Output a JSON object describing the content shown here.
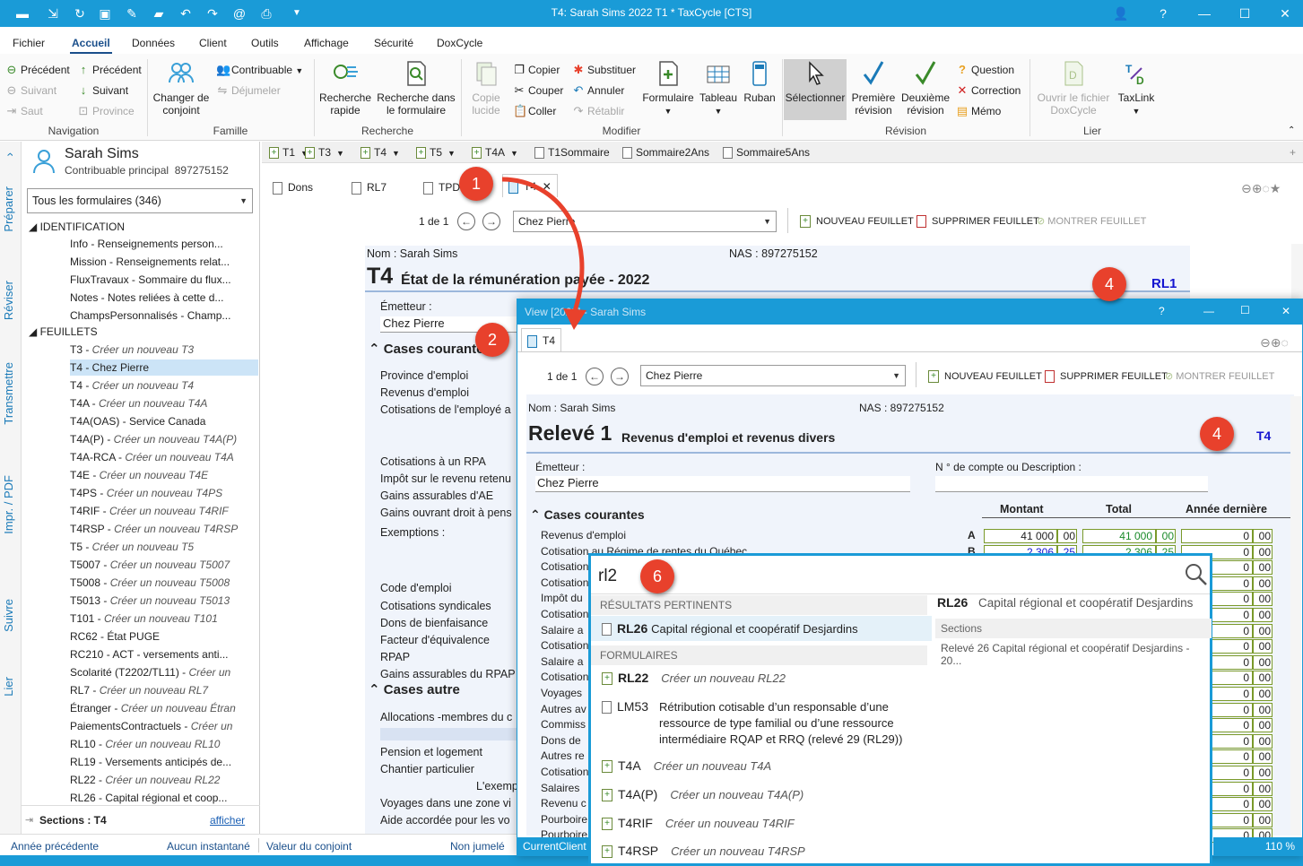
{
  "window": {
    "title": "T4: Sarah Sims 2022 T1 * TaxCycle [CTS]"
  },
  "menu": [
    "Fichier",
    "Accueil",
    "Données",
    "Client",
    "Outils",
    "Affichage",
    "Sécurité",
    "DoxCycle"
  ],
  "ribbon": {
    "prev1": "Précédent",
    "next1": "Suivant",
    "skip": "Saut",
    "prev2": "Précédent",
    "next2": "Suivant",
    "province": "Province",
    "change_spouse": "Changer de conjoint",
    "taxpayer": "Contribuable",
    "unlink": "Déjumeler",
    "quick_search": "Recherche rapide",
    "search_form": "Recherche dans le formulaire",
    "copy_lucid": "Copie lucide",
    "copy": "Copier",
    "cut": "Couper",
    "paste": "Coller",
    "substitute": "Substituer",
    "undo": "Annuler",
    "redo": "Rétablir",
    "form": "Formulaire",
    "table": "Tableau",
    "ribbon": "Ruban",
    "select": "Sélectionner",
    "first_review": "Première révision",
    "second_review": "Deuxième révision",
    "question": "Question",
    "correction": "Correction",
    "memo": "Mémo",
    "open_doxcycle": "Ouvrir le fichier DoxCycle",
    "taxlink": "TaxLink",
    "groups": {
      "navigation": "Navigation",
      "family": "Famille",
      "search": "Recherche",
      "modify": "Modifier",
      "review": "Révision",
      "link": "Lier"
    }
  },
  "sidetabs": [
    "Préparer",
    "Réviser",
    "Transmettre",
    "Impr. / PDF",
    "Suivre",
    "Lier"
  ],
  "client": {
    "name": "Sarah Sims",
    "role": "Contribuable principal",
    "sin": "897275152"
  },
  "filter": "Tous les formulaires (346)",
  "tree": {
    "identification": "IDENTIFICATION",
    "feuillets": "FEUILLETS",
    "id_items": [
      "Info - Renseignements person...",
      "Mission - Renseignements relat...",
      "FluxTravaux - Sommaire du flux...",
      "Notes - Notes reliées à cette d...",
      "ChampsPersonnalisés - Champ..."
    ],
    "slips": [
      {
        "code": "T3 - ",
        "desc": "Créer un nouveau T3"
      },
      {
        "code": "T4 - Chez Pierre",
        "desc": ""
      },
      {
        "code": "T4 - ",
        "desc": "Créer un nouveau T4"
      },
      {
        "code": "T4A - ",
        "desc": "Créer un nouveau T4A"
      },
      {
        "code": "T4A(OAS) - Service Canada",
        "desc": ""
      },
      {
        "code": "T4A(P) - ",
        "desc": "Créer un nouveau T4A(P)"
      },
      {
        "code": "T4A-RCA - ",
        "desc": "Créer un nouveau T4A"
      },
      {
        "code": "T4E - ",
        "desc": "Créer un nouveau T4E"
      },
      {
        "code": "T4PS - ",
        "desc": "Créer un nouveau T4PS"
      },
      {
        "code": "T4RIF - ",
        "desc": "Créer un nouveau T4RIF"
      },
      {
        "code": "T4RSP - ",
        "desc": "Créer un nouveau T4RSP"
      },
      {
        "code": "T5 - ",
        "desc": "Créer un nouveau T5"
      },
      {
        "code": "T5007 - ",
        "desc": "Créer un nouveau T5007"
      },
      {
        "code": "T5008 - ",
        "desc": "Créer un nouveau T5008"
      },
      {
        "code": "T5013 - ",
        "desc": "Créer un nouveau T5013"
      },
      {
        "code": "T101 - ",
        "desc": "Créer un nouveau T101"
      },
      {
        "code": "RC62 - État PUGE",
        "desc": ""
      },
      {
        "code": "RC210 - ACT - versements anti...",
        "desc": ""
      },
      {
        "code": "Scolarité (T2202/TL11) - ",
        "desc": "Créer un"
      },
      {
        "code": "RL7 - ",
        "desc": "Créer un nouveau RL7"
      },
      {
        "code": "Étranger - ",
        "desc": "Créer un nouveau Étran"
      },
      {
        "code": "PaiementsContractuels - ",
        "desc": "Créer un"
      },
      {
        "code": "RL10 - ",
        "desc": "Créer un nouveau RL10"
      },
      {
        "code": "RL19 - Versements anticipés de...",
        "desc": ""
      },
      {
        "code": "RL22 - ",
        "desc": "Créer un nouveau RL22"
      },
      {
        "code": "RL26 - Capital régional et coop...",
        "desc": ""
      }
    ],
    "sections_label": "Sections : T4",
    "show": "afficher"
  },
  "status": {
    "prev_year": "Année précédente",
    "no_snapshot": "Aucun instantané",
    "spouse_value": "Valeur du conjoint",
    "not_paired": "Non jumelé",
    "current_client": "CurrentClient",
    "zoom": "110 %"
  },
  "doctabs": [
    "T1",
    "T3",
    "T4",
    "T5",
    "T4A",
    "T1Sommaire",
    "Sommaire2Ans",
    "Sommaire5Ans"
  ],
  "formtabs": [
    "Dons",
    "RL7",
    "TPD",
    "T4"
  ],
  "pager": {
    "page": "1 de 1",
    "combo": "Chez Pierre",
    "new_slip": "NOUVEAU FEUILLET",
    "delete_slip": "SUPPRIMER FEUILLET",
    "show_slip": "MONTRER FEUILLET"
  },
  "t4": {
    "name": "Nom : Sarah Sims",
    "sin": "NAS : 897275152",
    "code": "T4",
    "title": "État de la rémunération payée - 2022",
    "link": "RL1",
    "issuer_label": "Émetteur :",
    "issuer": "Chez Pierre",
    "common": "Cases courantes",
    "other": "Cases autre",
    "lines": [
      "Province d'emploi",
      "Revenus d'emploi",
      "Cotisations de l'employé a",
      "Cotisations à un RPA",
      "Impôt sur le revenu retenu",
      "Gains assurables d'AE",
      "Gains ouvrant droit à pens",
      "Exemptions :",
      "Code d'emploi",
      "Cotisations syndicales",
      "Dons de bienfaisance",
      "Facteur d'équivalence",
      "RPAP",
      "Gains assurables du RPAP"
    ],
    "other_lines": [
      "Allocations -membres du c",
      "Pension et logement",
      "Chantier particulier",
      "L'exemp",
      "Voyages dans une zone vi",
      "Aide accordée pour les vo"
    ]
  },
  "bubbles": [
    "1",
    "2",
    "4",
    "4",
    "6"
  ],
  "view": {
    "title": "View [2022] - Sarah Sims",
    "tab": "T4",
    "name": "Nom : Sarah Sims",
    "sin": "NAS : 897275152",
    "code": "Relevé 1",
    "title2": "Revenus d'emploi et revenus divers",
    "link": "T4",
    "issuer_label": "Émetteur :",
    "issuer": "Chez Pierre",
    "account_label": "N ° de compte ou Description :",
    "common": "Cases courantes",
    "cols": [
      "Montant",
      "Total",
      "Année dernière"
    ],
    "lines": [
      "Revenus d'emploi",
      "Cotisation au Régime de rentes du Québec",
      "Cotisation",
      "Cotisation",
      "Impôt du",
      "Cotisation",
      "Salaire a",
      "Cotisation",
      "Salaire a",
      "Cotisation",
      "Voyages",
      "Autres av",
      "Commiss",
      "Dons de",
      "Autres re",
      "Cotisation",
      "Salaires",
      "Revenu c",
      "Pourboire",
      "Pourboire"
    ],
    "boxA": "A",
    "boxB": "B",
    "amount_a": "41 000",
    "cents_a": "00",
    "total_a": "41 000",
    "tcents_a": "00",
    "amount_b": "2 306",
    "cents_b": "25",
    "total_b": "2 306",
    "tcents_b": "25",
    "zero": "0",
    "zc": "00"
  },
  "search": {
    "query": "rl2",
    "relevant": "RÉSULTATS PERTINENTS",
    "forms": "FORMULAIRES",
    "results": [
      {
        "code": "RL26",
        "desc": "Capital régional et coopératif Desjardins"
      }
    ],
    "form_results": [
      {
        "code": "RL22",
        "desc": "Créer un nouveau RL22"
      },
      {
        "code": "LM53",
        "desc": "Rétribution cotisable d’un responsable d’une ressource de type familial ou d’une ressource intermédiaire RQAP et RRQ (relevé 29 (RL29))"
      },
      {
        "code": "T4A",
        "desc": "Créer un nouveau T4A"
      },
      {
        "code": "T4A(P)",
        "desc": "Créer un nouveau T4A(P)"
      },
      {
        "code": "T4RIF",
        "desc": "Créer un nouveau T4RIF"
      },
      {
        "code": "T4RSP",
        "desc": "Créer un nouveau T4RSP"
      }
    ],
    "preview_code": "RL26",
    "preview_desc": "Capital régional et coopératif Desjardins",
    "sections": "Sections",
    "section_item": "Relevé 26 Capital régional et coopératif Desjardins - 20..."
  },
  "colors": {
    "accent": "#1a9bd7",
    "bubble": "#e8412c"
  }
}
